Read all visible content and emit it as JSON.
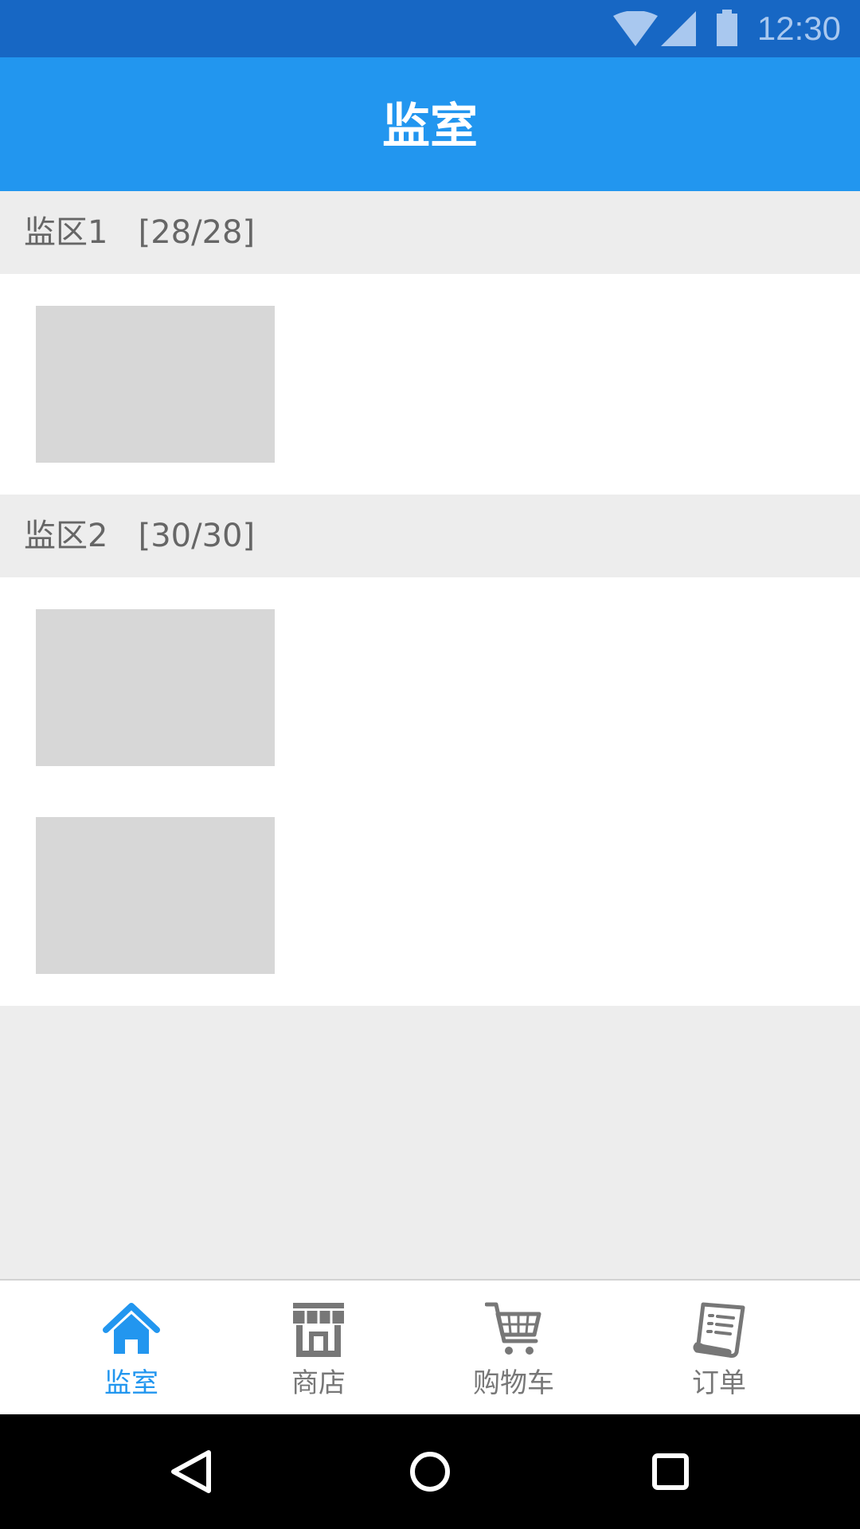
{
  "status_bar": {
    "time": "12:30",
    "icons": [
      "wifi-icon",
      "signal-icon",
      "battery-icon"
    ]
  },
  "app_bar": {
    "title": "监室"
  },
  "sections": [
    {
      "title": "监区1   [28/28]"
    },
    {
      "title": "监区2   [30/30]"
    }
  ],
  "tab_bar": {
    "tabs": [
      {
        "label": "监室",
        "icon": "home-icon",
        "active": true
      },
      {
        "label": "商店",
        "icon": "store-icon",
        "active": false
      },
      {
        "label": "购物车",
        "icon": "cart-icon",
        "active": false
      },
      {
        "label": "订单",
        "icon": "receipt-icon",
        "active": false
      }
    ]
  },
  "nav_bar": {
    "buttons": [
      "back-icon",
      "home-circle-icon",
      "recents-icon"
    ]
  },
  "colors": {
    "status_bar": "#1767c4",
    "app_bar": "#2296ef",
    "accent": "#2296ef",
    "section_bg": "#ededed",
    "placeholder": "#d7d7d7",
    "inactive_tab": "#777777"
  }
}
